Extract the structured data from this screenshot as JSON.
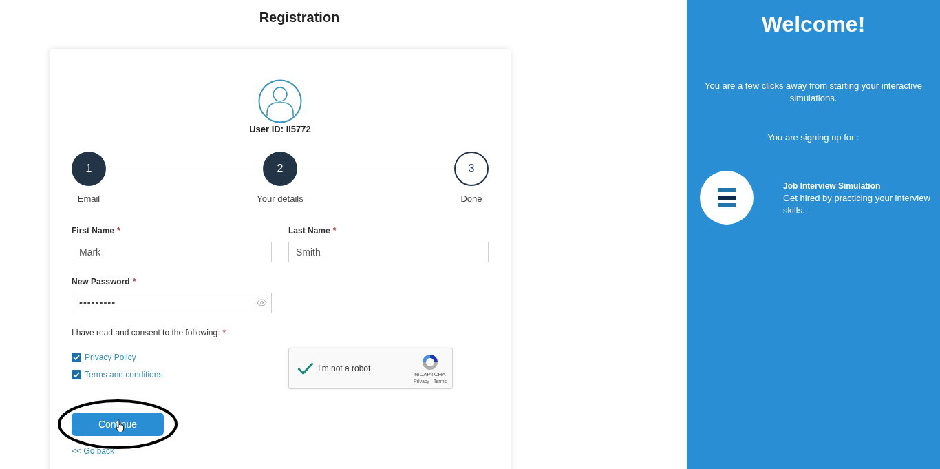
{
  "page": {
    "title": "Registration"
  },
  "profile": {
    "user_id": "User ID: II5772"
  },
  "stepper": [
    {
      "number": "1",
      "label": "Email",
      "completed": true
    },
    {
      "number": "2",
      "label": "Your details",
      "completed": true
    },
    {
      "number": "3",
      "label": "Done",
      "completed": false
    }
  ],
  "form": {
    "fields": [
      {
        "label": "First Name",
        "required_mark": "*",
        "value": "Mark",
        "kind": "text"
      },
      {
        "label": "Last Name",
        "required_mark": "*",
        "value": "Smith",
        "kind": "text"
      },
      {
        "label": "New Password",
        "required_mark": "*",
        "value": "•••••••••",
        "kind": "password"
      }
    ],
    "consent": {
      "label": "I have read and consent to the following:",
      "required_mark": "*",
      "items": [
        {
          "label": "Privacy Policy",
          "checked": true
        },
        {
          "label": "Terms and conditions",
          "checked": true
        }
      ]
    },
    "captcha": {
      "label": "I'm not a robot",
      "checked": true,
      "brand": "reCAPTCHA",
      "links": "Privacy - Terms"
    },
    "continue_button": "Continue",
    "back_link": "<< Go back"
  },
  "welcome": {
    "title": "Welcome!",
    "intro": "You are a few clicks away from starting your interactive simulations.",
    "signup_label": "You are signing up for :",
    "product": {
      "name": "Job Interview Simulation",
      "description": "Get hired by practicing your interview skills."
    }
  }
}
